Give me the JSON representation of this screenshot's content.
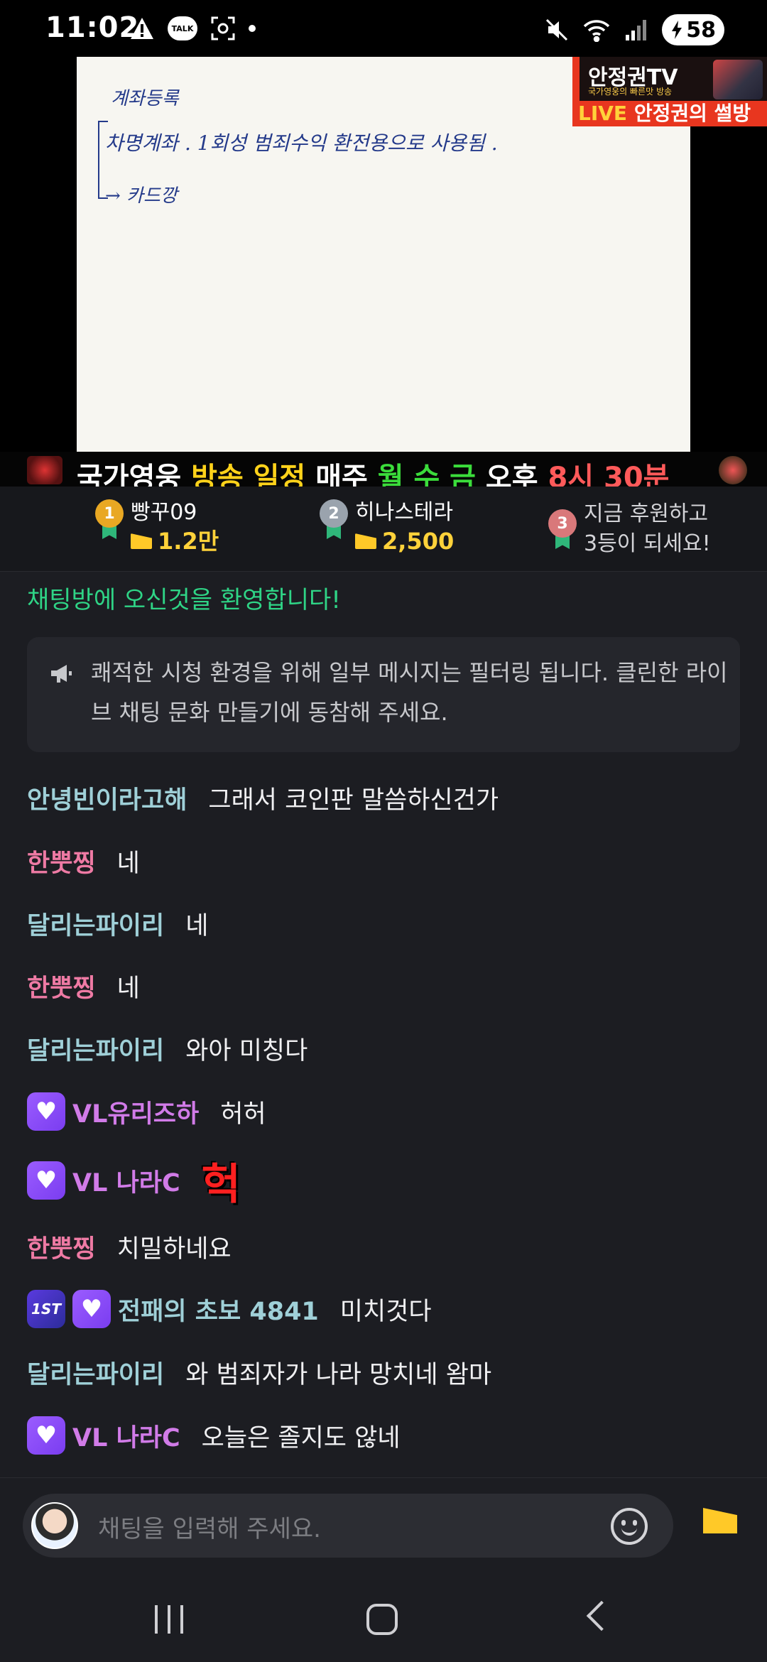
{
  "status_bar": {
    "time": "11:02",
    "talk_label": "TALK",
    "battery": "58"
  },
  "video": {
    "whiteboard": {
      "line1": "계좌등록",
      "line2": "차명계좌 . 1회성 범죄수익 환전용으로 사용됨 .",
      "line3": "→ 카드깡"
    },
    "channel": {
      "name": "안정권TV",
      "tagline": "국가영웅의 빠른맛 방송",
      "live_label": "LIVE",
      "show_title": "안정권의 썰방"
    },
    "ticker": {
      "part1": "국가영웅 ",
      "part2": "방송 일정 ",
      "part3": "매주 ",
      "part4": "월 수 금 ",
      "part5": "오후 ",
      "part6": "8시 30분"
    }
  },
  "ranking": {
    "first": {
      "rank": "1",
      "name": "빵꾸09",
      "amount": "1.2만"
    },
    "second": {
      "rank": "2",
      "name": "히나스테라",
      "amount": "2,500"
    },
    "third": {
      "rank": "3",
      "line1": "지금 후원하고",
      "line2": "3등이 되세요!"
    }
  },
  "chat": {
    "welcome": "채팅방에 오신것을 환영합니다!",
    "notice": "쾌적한 시청 환경을 위해 일부 메시지는 필터링 됩니다. 클린한 라이브 채팅 문화 만들기에 동참해 주세요.",
    "messages": [
      {
        "nick": "안녕빈이라고해",
        "text": "그래서 코인판 말씀하신건가"
      },
      {
        "nick": "한뿟찡",
        "text": "네"
      },
      {
        "nick": "달리는파이리",
        "text": "네"
      },
      {
        "nick": "한뿟찡",
        "text": "네"
      },
      {
        "nick": "달리는파이리",
        "text": "와아 미칭다"
      },
      {
        "nick": "VL유리즈하",
        "text": "허허"
      },
      {
        "nick": "VL 나라C",
        "text": "헉"
      },
      {
        "nick": "한뿟찡",
        "text": "치밀하네요"
      },
      {
        "nick": "전패의 초보 4841",
        "text": "미치것다",
        "badge_text": "1ST"
      },
      {
        "nick": "달리는파이리",
        "text": "와 범죄자가 나라 망치네 왐마"
      },
      {
        "nick": "VL 나라C",
        "text": "오늘은 졸지도 않네"
      }
    ]
  },
  "input": {
    "placeholder": "채팅을 입력해 주세요."
  },
  "colors": {
    "accent_green": "#2fd486",
    "cheese_yellow": "#ffc928",
    "nick_blue": "#9fd0d8",
    "nick_pink": "#ee7aa4",
    "nick_purple": "#d17be8"
  }
}
